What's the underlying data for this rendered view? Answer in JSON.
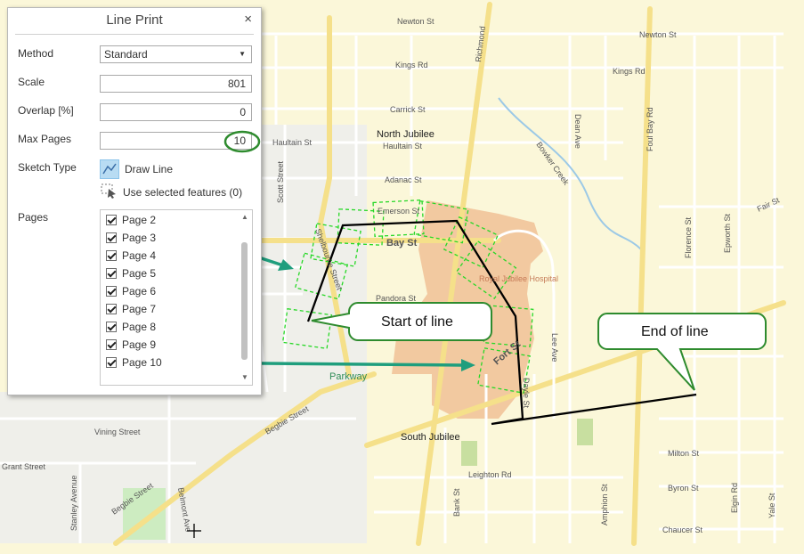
{
  "panel": {
    "title": "Line Print",
    "close_glyph": "×",
    "labels": {
      "method": "Method",
      "scale": "Scale",
      "overlap": "Overlap [%]",
      "max_pages": "Max Pages",
      "sketch_type": "Sketch Type",
      "pages": "Pages"
    },
    "method_value": "Standard",
    "scale_value": "801",
    "overlap_value": "0",
    "max_pages_value": "10",
    "sketch_options": {
      "draw_line": "Draw Line",
      "use_selected": "Use selected features (0)"
    },
    "pages": [
      "Page 2",
      "Page 3",
      "Page 4",
      "Page 5",
      "Page 6",
      "Page 7",
      "Page 8",
      "Page 9",
      "Page 10"
    ]
  },
  "callouts": {
    "start": "Start of line",
    "end": "End of line"
  },
  "map": {
    "streets": [
      "Newton St",
      "Newton St",
      "Kings Rd",
      "Kings Rd",
      "Richmond",
      "Dean Ave",
      "Foul Bay Rd",
      "Carrick St",
      "Haultain St",
      "Haultain St",
      "Adanac St",
      "Bowker Creek",
      "Emerson St",
      "Bay St",
      "Scott Street",
      "Shelbourne Street",
      "Pandora St",
      "Fort St",
      "Dayle St",
      "Lee Ave",
      "Florence St",
      "Epworth St",
      "Fair St",
      "Vining Street",
      "Begbie Street",
      "Grant Street",
      "Stanley Avenue",
      "Belmont Ave",
      "Bank St",
      "Amphion St",
      "Leighton Rd",
      "Milton St",
      "Byron St",
      "Elgin Rd",
      "Chaucer St",
      "Yale St",
      "Parkway"
    ],
    "places": [
      "North Jubilee",
      "South Jubilee",
      "Royal Jubilee Hospital"
    ],
    "colors": {
      "base": "#fbf7d9",
      "hospital": "#f2c9a0",
      "road": "#ffffff",
      "arterial": "#f5e08a",
      "line": "#000000",
      "pages_dash": "#27d827",
      "arrow": "#1f9e7d",
      "callout_border": "#2e8b2e",
      "park": "#cdecc1"
    }
  }
}
